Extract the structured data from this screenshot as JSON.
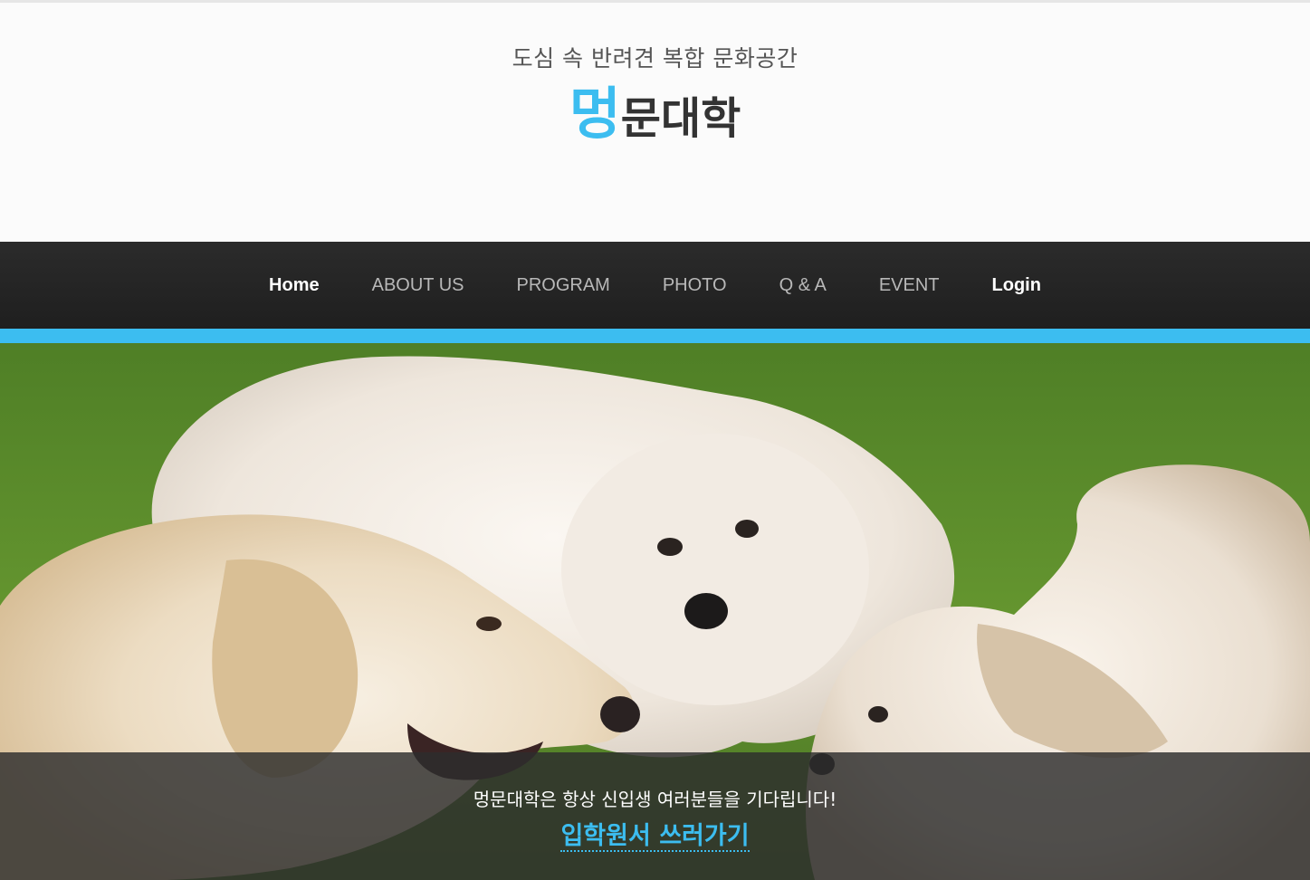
{
  "header": {
    "tagline": "도심 속 반려견 복합 문화공간",
    "logo_accent": "멍",
    "logo_rest": "문대학"
  },
  "nav": {
    "items": [
      {
        "label": "Home",
        "bold": true
      },
      {
        "label": "ABOUT US",
        "bold": false
      },
      {
        "label": "PROGRAM",
        "bold": false
      },
      {
        "label": "PHOTO",
        "bold": false
      },
      {
        "label": "Q & A",
        "bold": false
      },
      {
        "label": "EVENT",
        "bold": false
      },
      {
        "label": "Login",
        "bold": true
      }
    ]
  },
  "hero": {
    "caption_text": "멍문대학은 항상 신입생 여러분들을 기다립니다!",
    "cta_label": "입학원서 쓰러가기"
  },
  "colors": {
    "accent": "#3cbdf0",
    "nav_bg": "#252525",
    "text_dark": "#333333"
  }
}
